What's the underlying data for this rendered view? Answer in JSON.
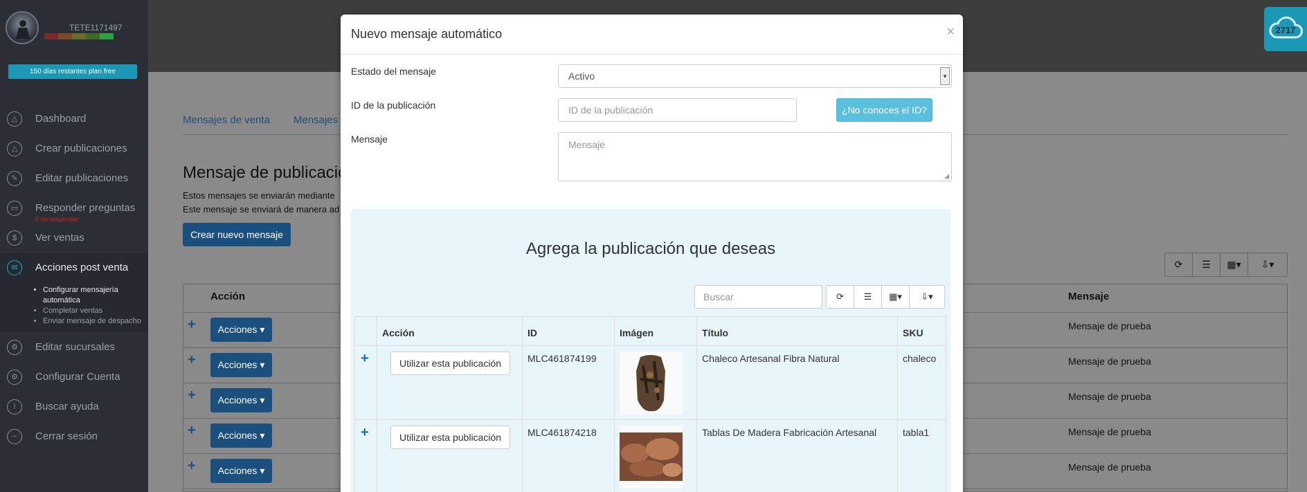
{
  "sidebar": {
    "username": "TETE1171497",
    "plan_badge": "150 días restantes plan free",
    "reputation_colors": [
      "#7a2a2a",
      "#7a4a2a",
      "#6b6b2a",
      "#3f6b2a",
      "#2ea043"
    ],
    "items": [
      {
        "label": "Dashboard",
        "icon": "triangle-icon"
      },
      {
        "label": "Crear publicaciones",
        "icon": "triangle-icon"
      },
      {
        "label": "Editar publicaciones",
        "icon": "pencil-icon"
      },
      {
        "label": "Responder preguntas",
        "icon": "chat-icon",
        "badge": "0 sin responder"
      },
      {
        "label": "Ver ventas",
        "icon": "dollar-icon"
      },
      {
        "label": "Acciones post venta",
        "icon": "mail-icon",
        "active": true
      },
      {
        "label": "Editar sucursales",
        "icon": "gear-icon"
      },
      {
        "label": "Configurar Cuenta",
        "icon": "gear-icon"
      },
      {
        "label": "Buscar ayuda",
        "icon": "exclamation-icon"
      },
      {
        "label": "Cerrar sesión",
        "icon": "minus-icon"
      }
    ],
    "subitems": [
      "Configurar mensajería automática",
      "Completar ventas",
      "Enviar mensaje de despacho"
    ]
  },
  "topbar": {
    "cloud_count": "2717"
  },
  "page": {
    "tabs": [
      "Mensajes de venta",
      "Mensajes d"
    ],
    "title": "Mensaje de publicació",
    "desc1": "Estos mensajes se enviarán mediante",
    "desc2": "Este mensaje se enviará de manera ad",
    "create_button": "Crear nuevo mensaje",
    "col_accion": "Acción",
    "col_mensaje": "Mensaje",
    "row_button": "Acciones",
    "row_message": "Mensaje de prueba",
    "accent": "#1b4f7d"
  },
  "modal": {
    "title": "Nuevo mensaje automático",
    "close": "×",
    "estado_label": "Estado del mensaje",
    "estado_value": "Activo",
    "id_label": "ID de la publicación",
    "id_placeholder": "ID de la publicación",
    "id_help_button": "¿No conoces el ID?",
    "mensaje_label": "Mensaje",
    "mensaje_placeholder": "Mensaje",
    "panel_title": "Agrega la publicación que deseas",
    "search_placeholder": "Buscar",
    "columns": [
      "Acción",
      "ID",
      "Imágen",
      "Título",
      "SKU"
    ],
    "use_button": "Utilizar esta publicación",
    "rows": [
      {
        "id": "MLC461874199",
        "title": "Chaleco Artesanal Fibra Natural",
        "sku": "chaleco",
        "image": "vest-photo"
      },
      {
        "id": "MLC461874218",
        "title": "Tablas De Madera Fabricación Artesanal",
        "sku": "tabla1",
        "image": "wood-boards-photo"
      }
    ],
    "info_color": "#5bc0de"
  }
}
